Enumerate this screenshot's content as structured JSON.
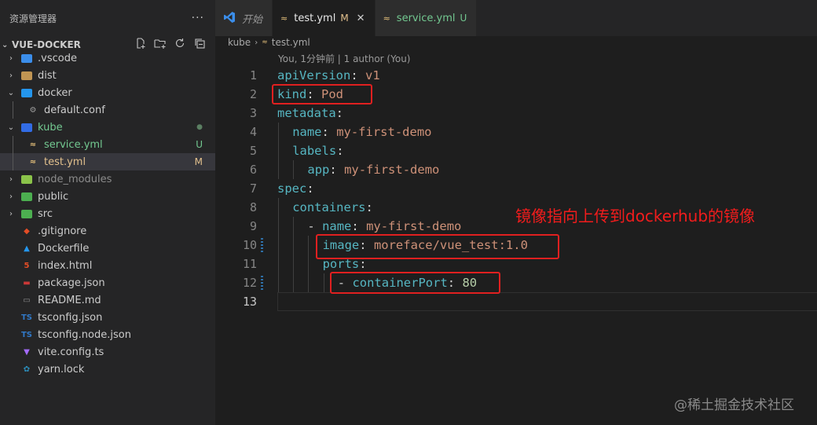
{
  "explorer": {
    "title": "资源管理器",
    "more": "···",
    "root_label": "VUE-DOCKER",
    "tools": [
      "new-file",
      "new-folder",
      "refresh",
      "collapse"
    ],
    "items": [
      {
        "label": ".vscode",
        "type": "folder",
        "chevron": "›",
        "indent": 0,
        "icon_color": "#3b8eea",
        "icon_text": ""
      },
      {
        "label": "dist",
        "type": "folder",
        "chevron": "›",
        "indent": 0,
        "icon_color": "#c09553",
        "icon_text": ""
      },
      {
        "label": "docker",
        "type": "folder",
        "chevron": "⌄",
        "indent": 0,
        "icon_color": "#2496ed",
        "icon_text": ""
      },
      {
        "label": "default.conf",
        "type": "file",
        "chevron": "",
        "indent": 1,
        "icon_color": "#9e9e9e",
        "icon_text": "⚙"
      },
      {
        "label": "kube",
        "type": "folder",
        "chevron": "⌄",
        "indent": 0,
        "icon_color": "#326ce5",
        "icon_text": "",
        "label_color": "#73c991",
        "badge": "●",
        "badge_color": "#5b7f62"
      },
      {
        "label": "service.yml",
        "type": "file",
        "chevron": "",
        "indent": 1,
        "icon_color": "#e5c07b",
        "icon_text": "≈",
        "label_color": "#73c991",
        "badge": "U",
        "badge_color": "#73c991"
      },
      {
        "label": "test.yml",
        "type": "file",
        "chevron": "",
        "indent": 1,
        "icon_color": "#e5c07b",
        "icon_text": "≈",
        "label_color": "#e2c08d",
        "badge": "M",
        "badge_color": "#e2c08d",
        "selected": true
      },
      {
        "label": "node_modules",
        "type": "folder",
        "chevron": "›",
        "indent": 0,
        "icon_color": "#8bc34a",
        "icon_text": "",
        "dim": true
      },
      {
        "label": "public",
        "type": "folder",
        "chevron": "›",
        "indent": 0,
        "icon_color": "#4caf50",
        "icon_text": ""
      },
      {
        "label": "src",
        "type": "folder",
        "chevron": "›",
        "indent": 0,
        "icon_color": "#4caf50",
        "icon_text": ""
      },
      {
        "label": ".gitignore",
        "type": "file",
        "chevron": "",
        "indent": 0,
        "icon_color": "#e44d26",
        "icon_text": "◆"
      },
      {
        "label": "Dockerfile",
        "type": "file",
        "chevron": "",
        "indent": 0,
        "icon_color": "#2496ed",
        "icon_text": "▲"
      },
      {
        "label": "index.html",
        "type": "file",
        "chevron": "",
        "indent": 0,
        "icon_color": "#e44d26",
        "icon_text": "5"
      },
      {
        "label": "package.json",
        "type": "file",
        "chevron": "",
        "indent": 0,
        "icon_color": "#cb3837",
        "icon_text": "▬"
      },
      {
        "label": "README.md",
        "type": "file",
        "chevron": "",
        "indent": 0,
        "icon_color": "#8c8c8c",
        "icon_text": "▭"
      },
      {
        "label": "tsconfig.json",
        "type": "file",
        "chevron": "",
        "indent": 0,
        "icon_color": "#3178c6",
        "icon_text": "TS"
      },
      {
        "label": "tsconfig.node.json",
        "type": "file",
        "chevron": "",
        "indent": 0,
        "icon_color": "#3178c6",
        "icon_text": "TS"
      },
      {
        "label": "vite.config.ts",
        "type": "file",
        "chevron": "",
        "indent": 0,
        "icon_color": "#a46bff",
        "icon_text": "▼"
      },
      {
        "label": "yarn.lock",
        "type": "file",
        "chevron": "",
        "indent": 0,
        "icon_color": "#2c8ebb",
        "icon_text": "✿"
      }
    ]
  },
  "tabs": [
    {
      "label": "开始",
      "icon": "vscode",
      "icon_color": "#3b8eea",
      "italic": true,
      "active": false,
      "status": "",
      "close": ""
    },
    {
      "label": "test.yml",
      "icon": "yaml",
      "icon_color": "#e5c07b",
      "italic": false,
      "active": true,
      "status": "M",
      "status_color": "#e2c08d",
      "close": "✕"
    },
    {
      "label": "service.yml",
      "icon": "yaml",
      "icon_color": "#e5c07b",
      "italic": false,
      "active": false,
      "status": "U",
      "status_color": "#73c991",
      "label_color": "#73c991",
      "close": ""
    }
  ],
  "breadcrumb": {
    "folder": "kube",
    "file": "test.yml"
  },
  "blame": "You, 1分钟前 | 1 author (You)",
  "code_lines": [
    {
      "num": "1",
      "parts": [
        [
          "k",
          "apiVersion"
        ],
        [
          "p",
          ": "
        ],
        [
          "v",
          "v1"
        ]
      ],
      "indent": 0
    },
    {
      "num": "2",
      "parts": [
        [
          "k",
          "kind"
        ],
        [
          "p",
          ": "
        ],
        [
          "v",
          "Pod"
        ]
      ],
      "indent": 0
    },
    {
      "num": "3",
      "parts": [
        [
          "k",
          "metadata"
        ],
        [
          "p",
          ":"
        ]
      ],
      "indent": 0
    },
    {
      "num": "4",
      "parts": [
        [
          "k",
          "name"
        ],
        [
          "p",
          ": "
        ],
        [
          "v",
          "my-first-demo"
        ]
      ],
      "indent": 1
    },
    {
      "num": "5",
      "parts": [
        [
          "k",
          "labels"
        ],
        [
          "p",
          ":"
        ]
      ],
      "indent": 1
    },
    {
      "num": "6",
      "parts": [
        [
          "k",
          "app"
        ],
        [
          "p",
          ": "
        ],
        [
          "v",
          "my-first-demo"
        ]
      ],
      "indent": 2
    },
    {
      "num": "7",
      "parts": [
        [
          "k",
          "spec"
        ],
        [
          "p",
          ":"
        ]
      ],
      "indent": 0
    },
    {
      "num": "8",
      "parts": [
        [
          "k",
          "containers"
        ],
        [
          "p",
          ":"
        ]
      ],
      "indent": 1
    },
    {
      "num": "9",
      "parts": [
        [
          "d",
          "- "
        ],
        [
          "k",
          "name"
        ],
        [
          "p",
          ": "
        ],
        [
          "v",
          "my-first-demo"
        ]
      ],
      "indent": 2
    },
    {
      "num": "10",
      "parts": [
        [
          "k",
          "image"
        ],
        [
          "p",
          ": "
        ],
        [
          "v",
          "moreface/vue_test:1.0"
        ]
      ],
      "indent": 3,
      "gutter": true
    },
    {
      "num": "11",
      "parts": [
        [
          "k",
          "ports"
        ],
        [
          "p",
          ":"
        ]
      ],
      "indent": 3
    },
    {
      "num": "12",
      "parts": [
        [
          "d",
          "- "
        ],
        [
          "k",
          "containerPort"
        ],
        [
          "p",
          ": "
        ],
        [
          "n",
          "80"
        ]
      ],
      "indent": 4,
      "gutter": true
    },
    {
      "num": "13",
      "parts": [],
      "indent": 0,
      "current": true
    }
  ],
  "annotation": "镜像指向上传到dockerhub的镜像",
  "watermark": "@稀土掘金技术社区",
  "colors": {
    "annotation_red": "#e02020",
    "accent_blue": "#3b8eea"
  }
}
